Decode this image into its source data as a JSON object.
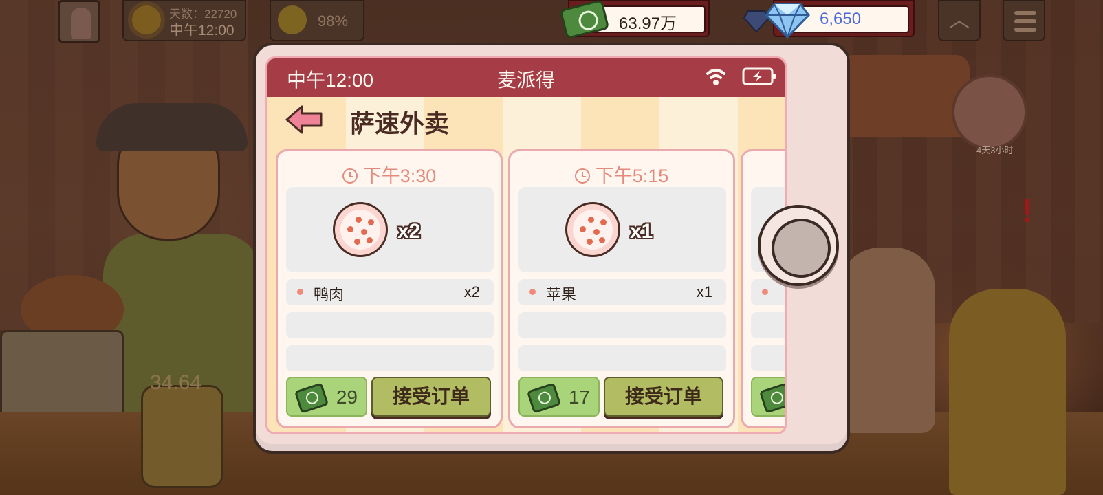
{
  "hud": {
    "days": "天数：22720",
    "time": "中午12:00",
    "mood": "98%",
    "money": "63.97万",
    "gems": "6,650"
  },
  "background": {
    "jar_value": "34.64",
    "timer": "4天3小时"
  },
  "phone": {
    "status_time": "中午12:00",
    "carrier": "麦派得",
    "app_title": "萨速外卖",
    "orders": [
      {
        "time": "下午3:30",
        "item_qty": "x2",
        "ingredients": [
          {
            "name": "鸭肉",
            "qty": "x2"
          }
        ],
        "reward": "29",
        "accept_label": "接受订单"
      },
      {
        "time": "下午5:15",
        "item_qty": "x1",
        "ingredients": [
          {
            "name": "苹果",
            "qty": "x1"
          }
        ],
        "reward": "17",
        "accept_label": "接受订单"
      }
    ]
  },
  "colors": {
    "status_bar": "#a53c46",
    "accent_time": "#e48a7c",
    "reward_bg": "#a9d47a",
    "accept_bg": "#b2bc63",
    "gems_text": "#4d6bd8"
  }
}
